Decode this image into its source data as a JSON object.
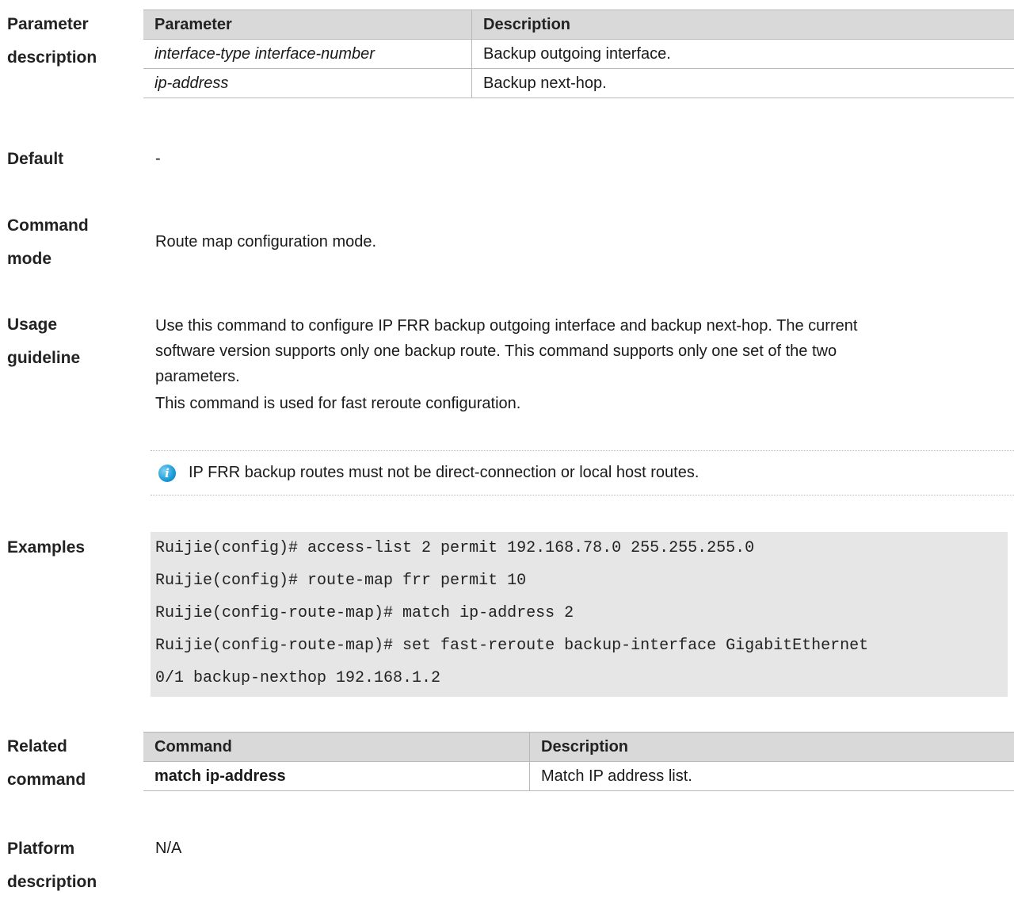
{
  "param_section": {
    "label_line1": "Parameter",
    "label_line2": "description",
    "headers": [
      "Parameter",
      "Description"
    ],
    "rows": [
      {
        "param": "interface-type interface-number",
        "desc": "Backup outgoing interface."
      },
      {
        "param": "ip-address",
        "desc": "Backup next-hop."
      }
    ]
  },
  "default_section": {
    "label": "Default",
    "value": "-"
  },
  "mode_section": {
    "label_line1": "Command",
    "label_line2": "mode",
    "value": "Route map configuration mode."
  },
  "usage_section": {
    "label_line1": "Usage",
    "label_line2": "guideline",
    "lines": [
      "Use this command to configure IP FRR backup outgoing interface and backup next-hop. The current",
      "software version supports only one backup route. This command supports only one set of the two",
      "parameters.",
      "This command is used for fast reroute configuration."
    ],
    "note_icon": "info-icon",
    "note": "IP FRR backup routes must not be direct-connection or local host routes."
  },
  "examples_section": {
    "label": "Examples",
    "code_lines": [
      "Ruijie(config)# access-list 2 permit 192.168.78.0 255.255.255.0",
      "Ruijie(config)# route-map frr permit 10",
      "Ruijie(config-route-map)# match ip-address 2",
      "Ruijie(config-route-map)# set fast-reroute backup-interface GigabitEthernet",
      "0/1 backup-nexthop 192.168.1.2"
    ]
  },
  "related_section": {
    "label_line1": "Related",
    "label_line2": "command",
    "headers": [
      "Command",
      "Description"
    ],
    "rows": [
      {
        "command": "match ip-address",
        "desc": "Match IP address list."
      }
    ]
  },
  "platform_section": {
    "label_line1": "Platform",
    "label_line2": "description",
    "value": "N/A"
  },
  "colors": {
    "table_header_bg": "#d9d9d9",
    "code_bg": "#e6e6e6",
    "info_icon": "#1a9ad6"
  }
}
